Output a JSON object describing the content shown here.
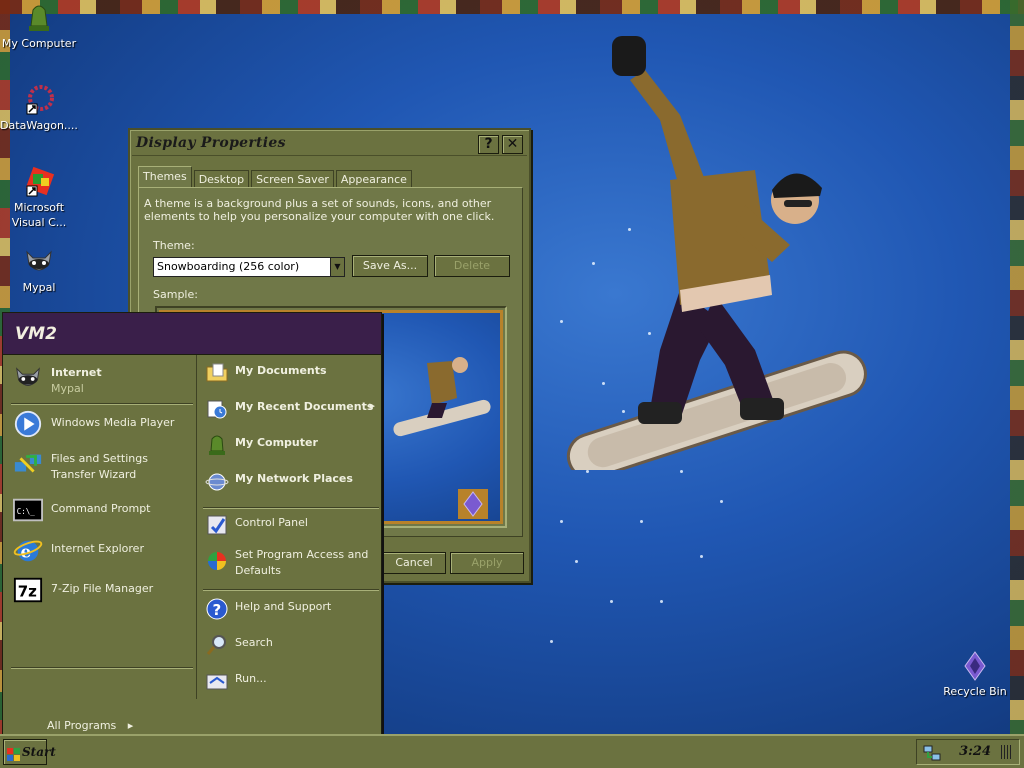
{
  "desktop": {
    "icons": [
      {
        "label": "My Computer",
        "icon": "my-computer-icon"
      },
      {
        "label": "DataWagon....",
        "icon": "datawagon-icon"
      },
      {
        "label": "Microsoft Visual C...",
        "icon": "visual-studio-icon"
      },
      {
        "label": "Mypal",
        "icon": "mypal-icon"
      },
      {
        "label": "Recycle Bin",
        "icon": "recycle-bin-icon"
      }
    ]
  },
  "display_properties": {
    "title": "Display Properties",
    "help_button": "?",
    "close_button": "✕",
    "tabs": [
      "Themes",
      "Desktop",
      "Screen Saver",
      "Appearance"
    ],
    "active_tab": "Themes",
    "description": "A theme is a background plus a set of sounds, icons, and other elements to help you personalize your computer with one click.",
    "theme_label": "Theme:",
    "theme_value": "Snowboarding (256 color)",
    "save_as": "Save As...",
    "delete": "Delete",
    "sample_label": "Sample:",
    "cancel": "Cancel",
    "apply": "Apply"
  },
  "start_menu": {
    "user": "VM2",
    "pinned": [
      {
        "title": "Internet",
        "subtitle": "Mypal",
        "icon": "mypal-icon"
      }
    ],
    "recent": [
      {
        "title": "Windows Media Player",
        "icon": "media-player-icon"
      },
      {
        "title": "Files and Settings Transfer Wizard",
        "icon": "transfer-wizard-icon"
      },
      {
        "title": "Command Prompt",
        "icon": "command-prompt-icon"
      },
      {
        "title": "Internet Explorer",
        "icon": "internet-explorer-icon"
      },
      {
        "title": "7-Zip File Manager",
        "icon": "seven-zip-icon"
      }
    ],
    "all_programs": "All Programs",
    "right": [
      {
        "title": "My Documents",
        "icon": "my-documents-icon",
        "bold": true
      },
      {
        "title": "My Recent Documents",
        "icon": "recent-documents-icon",
        "bold": true
      },
      {
        "title": "My Computer",
        "icon": "my-computer-icon",
        "bold": true
      },
      {
        "title": "My Network Places",
        "icon": "network-places-icon",
        "bold": true
      },
      {
        "title": "Control Panel",
        "icon": "control-panel-icon",
        "bold": false
      },
      {
        "title": "Set Program Access and Defaults",
        "icon": "program-access-icon",
        "bold": false
      },
      {
        "title": "Help and Support",
        "icon": "help-icon",
        "bold": false
      },
      {
        "title": "Search",
        "icon": "search-icon",
        "bold": false
      },
      {
        "title": "Run...",
        "icon": "run-icon",
        "bold": false
      }
    ]
  },
  "taskbar": {
    "start_label": "Start",
    "clock": "3:24"
  },
  "colors": {
    "window_face": "#6b7240",
    "start_header": "#3a1f4a",
    "desktop_blue": "#2057b3"
  }
}
